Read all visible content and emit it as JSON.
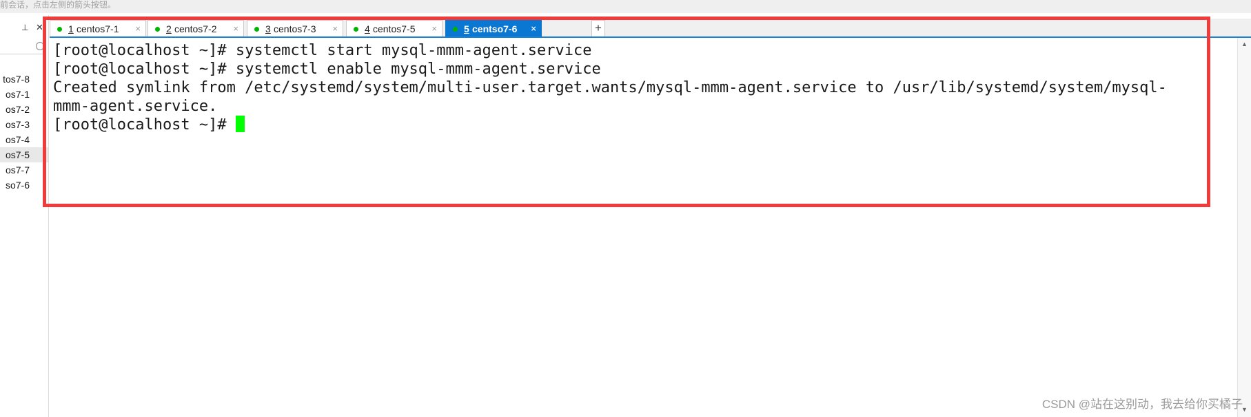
{
  "topbar": {
    "hint": "前会话，点击左侧的箭头按钮。"
  },
  "sidebar": {
    "sessions": [
      {
        "label": "tos7-8"
      },
      {
        "label": "os7-1"
      },
      {
        "label": "os7-2"
      },
      {
        "label": "os7-3"
      },
      {
        "label": "os7-4"
      },
      {
        "label": "os7-5",
        "selected": true
      },
      {
        "label": "os7-7"
      },
      {
        "label": "so7-6"
      }
    ]
  },
  "tabs": [
    {
      "num": "1",
      "label": "centos7-1",
      "close": "×",
      "status_color": "#00b400"
    },
    {
      "num": "2",
      "label": "centos7-2",
      "close": "×",
      "status_color": "#00b400"
    },
    {
      "num": "3",
      "label": "centos7-3",
      "close": "×",
      "status_color": "#00b400"
    },
    {
      "num": "4",
      "label": "centos7-5",
      "close": "×",
      "status_color": "#00b400"
    },
    {
      "num": "5",
      "label": "centso7-6",
      "close": "×",
      "status_color": "#00b400",
      "active": true
    }
  ],
  "add_tab_label": "+",
  "terminal": {
    "lines": [
      "[root@localhost ~]# systemctl start mysql-mmm-agent.service",
      "[root@localhost ~]# systemctl enable mysql-mmm-agent.service",
      "Created symlink from /etc/systemd/system/multi-user.target.wants/mysql-mmm-agent.service to /usr/lib/systemd/system/mysql-",
      "mmm-agent.service.",
      "[root@localhost ~]# "
    ],
    "cursor_color": "#00ff00"
  },
  "highlight_color": "#ef3b3b",
  "watermark": "CSDN @站在这别动，我去给你买橘子"
}
